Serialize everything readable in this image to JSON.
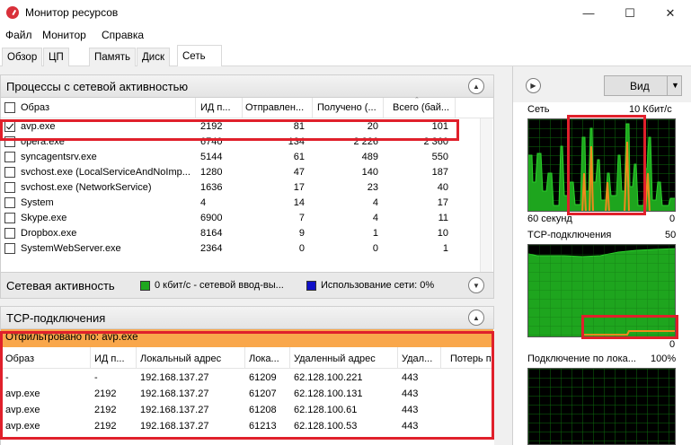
{
  "window": {
    "title": "Монитор ресурсов",
    "minimize_glyph": "—",
    "maximize_glyph": "☐",
    "close_glyph": "✕"
  },
  "menu": [
    "Файл",
    "Монитор",
    "Справка"
  ],
  "tabs": [
    {
      "label": "Обзор",
      "active": false
    },
    {
      "label": "ЦП",
      "active": false
    },
    {
      "label": "Память",
      "active": false
    },
    {
      "label": "Диск",
      "active": false
    },
    {
      "label": "Сеть",
      "active": true
    }
  ],
  "processes": {
    "title": "Процессы с сетевой активностью",
    "columns": [
      "Образ",
      "ИД п...",
      "Отправлен...",
      "Получено (...",
      "Всего (бай..."
    ],
    "rows": [
      {
        "checked": true,
        "image": "avp.exe",
        "pid": "2192",
        "sent": "81",
        "received": "20",
        "total": "101"
      },
      {
        "checked": false,
        "image": "opera.exe",
        "pid": "6740",
        "sent": "134",
        "received": "2 226",
        "total": "2 360"
      },
      {
        "checked": false,
        "image": "syncagentsrv.exe",
        "pid": "5144",
        "sent": "61",
        "received": "489",
        "total": "550"
      },
      {
        "checked": false,
        "image": "svchost.exe (LocalServiceAndNoImp...",
        "pid": "1280",
        "sent": "47",
        "received": "140",
        "total": "187"
      },
      {
        "checked": false,
        "image": "svchost.exe (NetworkService)",
        "pid": "1636",
        "sent": "17",
        "received": "23",
        "total": "40"
      },
      {
        "checked": false,
        "image": "System",
        "pid": "4",
        "sent": "14",
        "received": "4",
        "total": "17"
      },
      {
        "checked": false,
        "image": "Skype.exe",
        "pid": "6900",
        "sent": "7",
        "received": "4",
        "total": "11"
      },
      {
        "checked": false,
        "image": "Dropbox.exe",
        "pid": "8164",
        "sent": "9",
        "received": "1",
        "total": "10"
      },
      {
        "checked": false,
        "image": "SystemWebServer.exe",
        "pid": "2364",
        "sent": "0",
        "received": "0",
        "total": "1"
      }
    ]
  },
  "network_activity": {
    "title": "Сетевая активность",
    "io_label": "0 кбит/с - сетевой ввод-вы...",
    "usage_label": "Использование сети: 0%",
    "io_color": "#1fa71f",
    "usage_color": "#1010c8"
  },
  "tcp": {
    "title": "TCP-подключения",
    "filter": "Отфильтровано по: avp.exe",
    "columns": [
      "Образ",
      "ИД п...",
      "Локальный адрес",
      "Лока...",
      "Удаленный адрес",
      "Удал...",
      "Потерь п"
    ],
    "rows": [
      {
        "image": "-",
        "pid": "-",
        "local": "192.168.137.27",
        "lport": "61209",
        "remote": "62.128.100.221",
        "rport": "443"
      },
      {
        "image": "avp.exe",
        "pid": "2192",
        "local": "192.168.137.27",
        "lport": "61207",
        "remote": "62.128.100.131",
        "rport": "443"
      },
      {
        "image": "avp.exe",
        "pid": "2192",
        "local": "192.168.137.27",
        "lport": "61208",
        "remote": "62.128.100.61",
        "rport": "443"
      },
      {
        "image": "avp.exe",
        "pid": "2192",
        "local": "192.168.137.27",
        "lport": "61213",
        "remote": "62.128.100.53",
        "rport": "443"
      }
    ]
  },
  "graphs": {
    "view_button": "Вид",
    "network": {
      "title": "Сеть",
      "max": "10 Кбит/с",
      "time": "60 секунд",
      "min": "0"
    },
    "tcp": {
      "title": "TCP-подключения",
      "max": "50",
      "min": "0"
    },
    "local": {
      "title": "Подключение по лока...",
      "max": "100%"
    }
  },
  "colors": {
    "highlight": "#e0202b",
    "filter_bar": "#f9a74b",
    "graph_green": "#2bd12b",
    "graph_orange": "#f08a1c"
  }
}
